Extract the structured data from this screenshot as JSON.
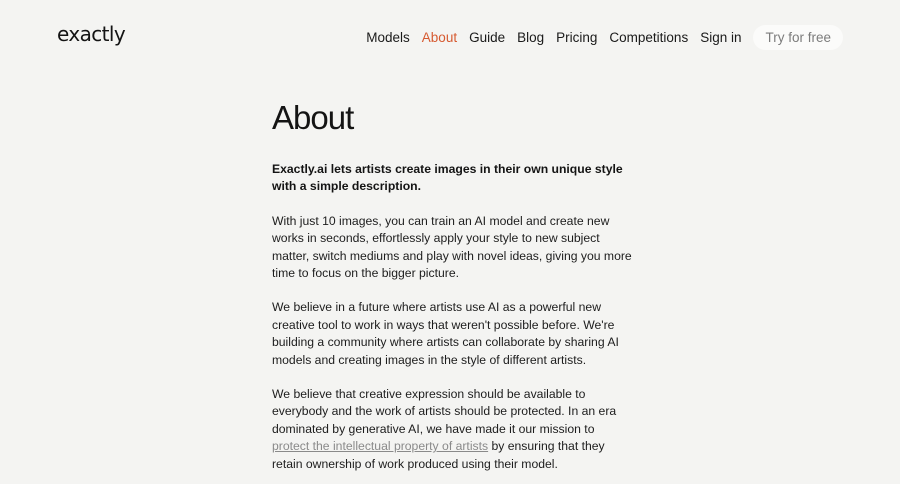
{
  "header": {
    "logo": "exactly",
    "nav": [
      {
        "label": "Models",
        "active": false
      },
      {
        "label": "About",
        "active": true
      },
      {
        "label": "Guide",
        "active": false
      },
      {
        "label": "Blog",
        "active": false
      },
      {
        "label": "Pricing",
        "active": false
      },
      {
        "label": "Competitions",
        "active": false
      },
      {
        "label": "Sign in",
        "active": false
      }
    ],
    "cta_label": "Try for free",
    "active_color": "#d65a31"
  },
  "main": {
    "title": "About",
    "lead": "Exactly.ai lets artists create images in their own unique style with a simple description.",
    "para1": "With just 10 images, you can train an AI model and create new works in seconds, effortlessly apply your style to new subject matter, switch mediums and play with novel ideas, giving you more time to focus on the bigger picture.",
    "para2": "We believe in a future where artists use AI as a powerful new creative tool to work in ways that weren't possible before. We're building a community where artists can collaborate by sharing AI models and creating images in the style of different artists.",
    "para3_before": "We believe that creative expression should be available to everybody and the work of artists should be protected. In an era dominated by generative AI, we have made it our mission to ",
    "para3_link": "protect the intellectual property of artists",
    "para3_after": " by ensuring that they retain ownership of work produced using their model."
  }
}
